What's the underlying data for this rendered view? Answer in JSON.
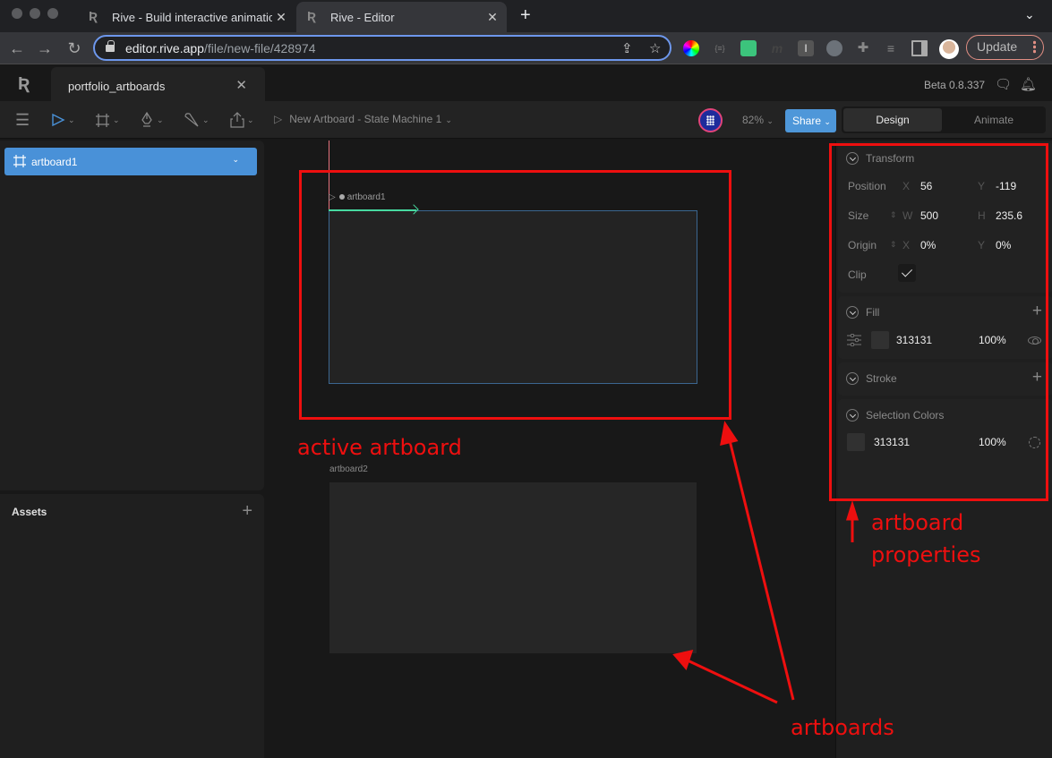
{
  "browser": {
    "tabs": [
      {
        "title": "Rive - Build interactive animatio",
        "active": false
      },
      {
        "title": "Rive - Editor",
        "active": true
      }
    ],
    "url_host": "editor.rive.app",
    "url_path": "/file/new-file/428974",
    "update_label": "Update",
    "extensions": [
      "color-wheel-extension",
      "json-extension",
      "bitmoji-extension",
      "m-extension",
      "i-extension",
      "key-extension",
      "puzzle-extensions",
      "media-queue",
      "sidebar"
    ]
  },
  "app": {
    "file_tab": "portfolio_artboards",
    "version": "Beta 0.8.337"
  },
  "toolbar": {
    "state_machine": "New Artboard - State Machine 1",
    "zoom": "82%",
    "share_label": "Share",
    "modes": [
      "Design",
      "Animate"
    ],
    "active_mode": "Design"
  },
  "hierarchy": {
    "items": [
      {
        "label": "artboard1",
        "selected": true
      }
    ]
  },
  "assets": {
    "title": "Assets"
  },
  "canvas": {
    "artboards": [
      {
        "label": "artboard1",
        "active": true
      },
      {
        "label": "artboard2",
        "active": false
      }
    ]
  },
  "properties": {
    "transform": {
      "title": "Transform",
      "position_label": "Position",
      "x": "56",
      "y": "-119",
      "size_label": "Size",
      "w": "500",
      "h": "235.6",
      "origin_label": "Origin",
      "origin_x": "0%",
      "origin_y": "0%",
      "clip_label": "Clip",
      "clip": true,
      "axis": {
        "x": "X",
        "y": "Y",
        "w": "W",
        "h": "H"
      }
    },
    "fill": {
      "title": "Fill",
      "color": "313131",
      "color_hex": "#313131",
      "opacity": "100%"
    },
    "stroke": {
      "title": "Stroke"
    },
    "selection_colors": {
      "title": "Selection Colors",
      "color": "313131",
      "color_hex": "#313131",
      "opacity": "100%"
    }
  },
  "annotations": {
    "active_artboard": "active artboard",
    "artboard_properties_1": "artboard",
    "artboard_properties_2": "properties",
    "artboards": "artboards",
    "color": "#ee0f0f"
  }
}
